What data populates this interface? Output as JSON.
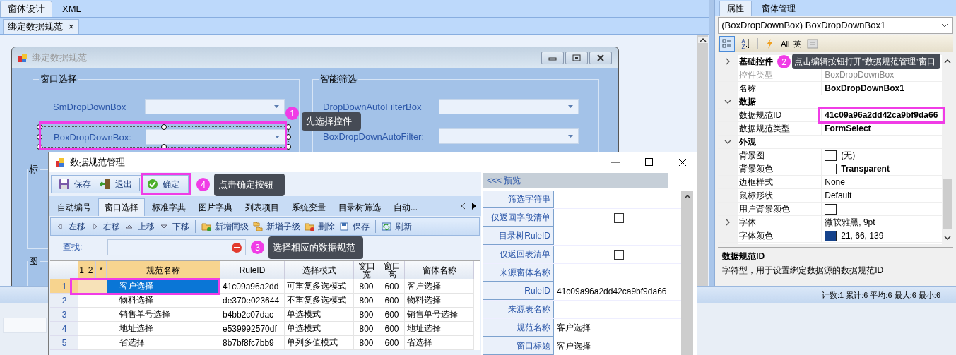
{
  "main_tabs": [
    {
      "label": "窗体设计",
      "selected": true
    },
    {
      "label": "XML",
      "selected": false
    }
  ],
  "document_tab": {
    "label": "绑定数据规范",
    "close": "×"
  },
  "designer_form": {
    "title": "绑定数据规范",
    "groups": [
      {
        "title": "窗口选择",
        "fields": [
          {
            "label": "SmDropDownBox",
            "selected": false
          },
          {
            "label": "BoxDropDownBox:",
            "selected": true
          }
        ]
      },
      {
        "title": "智能筛选",
        "fields": [
          {
            "label": "DropDownAutoFilterBox",
            "selected": false
          },
          {
            "label": "BoxDropDownAutoFilter:",
            "selected": false
          }
        ]
      }
    ],
    "partial_groups": [
      "标",
      "图"
    ]
  },
  "properties_panel": {
    "tabs": [
      {
        "label": "属性",
        "selected": true
      },
      {
        "label": "窗体管理",
        "selected": false
      }
    ],
    "object_selector": "(BoxDropDownBox) BoxDropDownBox1",
    "toolbar_texts": [
      "All",
      "英"
    ],
    "rows": [
      {
        "kind": "category",
        "name": "基础控件",
        "expanded": false
      },
      {
        "kind": "property",
        "name": "控件类型",
        "value": "BoxDropDownBox",
        "disabled": true,
        "bold": false
      },
      {
        "kind": "property",
        "name": "名称",
        "value": "BoxDropDownBox1",
        "disabled": false,
        "bold": true
      },
      {
        "kind": "category",
        "name": "数据",
        "expanded": true
      },
      {
        "kind": "property",
        "name": "数据规范ID",
        "value": "41c09a96a2dd42ca9bf9da66",
        "disabled": false,
        "bold": true
      },
      {
        "kind": "property",
        "name": "数据规范类型",
        "value": "FormSelect",
        "disabled": false,
        "bold": true
      },
      {
        "kind": "category",
        "name": "外观",
        "expanded": true
      },
      {
        "kind": "property",
        "name": "背景图",
        "color": "#ffffff",
        "value": "(无)",
        "disabled": false,
        "bold": false
      },
      {
        "kind": "property",
        "name": "背景颜色",
        "color": "#ffffff",
        "value": "Transparent",
        "disabled": false,
        "bold": true
      },
      {
        "kind": "property",
        "name": "边框样式",
        "value": "None",
        "disabled": false,
        "bold": false
      },
      {
        "kind": "property",
        "name": "鼠标形状",
        "value": "Default",
        "disabled": false,
        "bold": false
      },
      {
        "kind": "property",
        "name": "用户背景颜色",
        "color": "#ffffff",
        "disabled": false
      },
      {
        "kind": "property",
        "name": "字体",
        "value": "微软雅黑, 9pt",
        "expanded": false,
        "disabled": false,
        "bold": false
      },
      {
        "kind": "property",
        "name": "字体颜色",
        "color": "#15428b",
        "value": "21, 66, 139",
        "disabled": false,
        "bold": false
      }
    ],
    "description": {
      "title": "数据规范ID",
      "text": "字符型，用于设置绑定数据源的数据规范ID"
    }
  },
  "status_bar": "计数:1 累计:6 平均:6 最大:6 最小:6",
  "dialog": {
    "title": "数据规范管理",
    "toolbar": [
      "保存",
      "退出",
      "确定"
    ],
    "tabs": [
      {
        "label": "自动编号",
        "selected": false
      },
      {
        "label": "窗口选择",
        "selected": true
      },
      {
        "label": "标准字典",
        "selected": false
      },
      {
        "label": "图片字典",
        "selected": false
      },
      {
        "label": "列表项目",
        "selected": false
      },
      {
        "label": "系统变量",
        "selected": false
      },
      {
        "label": "目录树筛选",
        "selected": false
      },
      {
        "label": "自动...",
        "selected": false
      }
    ],
    "actions": [
      "左移",
      "右移",
      "上移",
      "下移",
      "新增同级",
      "新增子级",
      "删除",
      "保存",
      "刷新"
    ],
    "search": {
      "label": "查找:"
    },
    "table": {
      "columns": [
        {
          "label": "1",
          "highlighted": true
        },
        {
          "label": "2",
          "highlighted": true
        },
        {
          "label": "*",
          "highlighted": true
        },
        {
          "label": "规范名称",
          "highlighted": true
        },
        {
          "label": "RuleID",
          "highlighted": false
        },
        {
          "label": "选择模式",
          "highlighted": false
        },
        {
          "label": "窗口宽",
          "highlighted": false
        },
        {
          "label": "窗口高",
          "highlighted": false
        },
        {
          "label": "窗体名称",
          "highlighted": false
        }
      ],
      "rows": [
        {
          "number": "1",
          "selected": true,
          "cells": [
            "",
            "",
            "",
            "客户选择",
            "41c09a96a2dd",
            "可重复多选模式",
            "800",
            "600",
            "客户选择"
          ]
        },
        {
          "number": "2",
          "selected": false,
          "cells": [
            "",
            "",
            "",
            "物料选择",
            "de370e023644",
            "不重复多选模式",
            "800",
            "600",
            "物料选择"
          ]
        },
        {
          "number": "3",
          "selected": false,
          "cells": [
            "",
            "",
            "",
            "销售单号选择",
            "b4bb2c07dac",
            "单选模式",
            "800",
            "600",
            "销售单号选择"
          ]
        },
        {
          "number": "4",
          "selected": false,
          "cells": [
            "",
            "",
            "",
            "地址选择",
            "e539992570df",
            "单选模式",
            "800",
            "600",
            "地址选择"
          ]
        },
        {
          "number": "5",
          "selected": false,
          "cells": [
            "",
            "",
            "",
            "省选择",
            "8b7bf8fc7bb9",
            "单列多值模式",
            "800",
            "600",
            "省选择"
          ]
        }
      ]
    },
    "preview": {
      "title": "<<< 预览",
      "rows": [
        {
          "kind": "text",
          "label": "筛选字符串"
        },
        {
          "kind": "checkbox",
          "label": "仅返回字段清单",
          "checked": false
        },
        {
          "kind": "text",
          "label": "目录树RuleID"
        },
        {
          "kind": "checkbox",
          "label": "仅返回表清单",
          "checked": false
        },
        {
          "kind": "text",
          "label": "来源窗体名称"
        },
        {
          "kind": "text",
          "label": "RuleID",
          "value": "41c09a96a2dd42ca9bf9da66"
        },
        {
          "kind": "text",
          "label": "来源表名称"
        },
        {
          "kind": "text",
          "label": "规范名称",
          "value": "客户选择"
        },
        {
          "kind": "text",
          "label": "窗口标题",
          "value": "客户选择"
        }
      ]
    }
  },
  "annotations": [
    {
      "number": "1",
      "text": "先选择控件"
    },
    {
      "number": "2",
      "text": "点击编辑按钮打开“数据规范管理”窗口"
    },
    {
      "number": "3",
      "text": "选择相应的数据规范"
    },
    {
      "number": "4",
      "text": "点击确定按钮"
    }
  ]
}
